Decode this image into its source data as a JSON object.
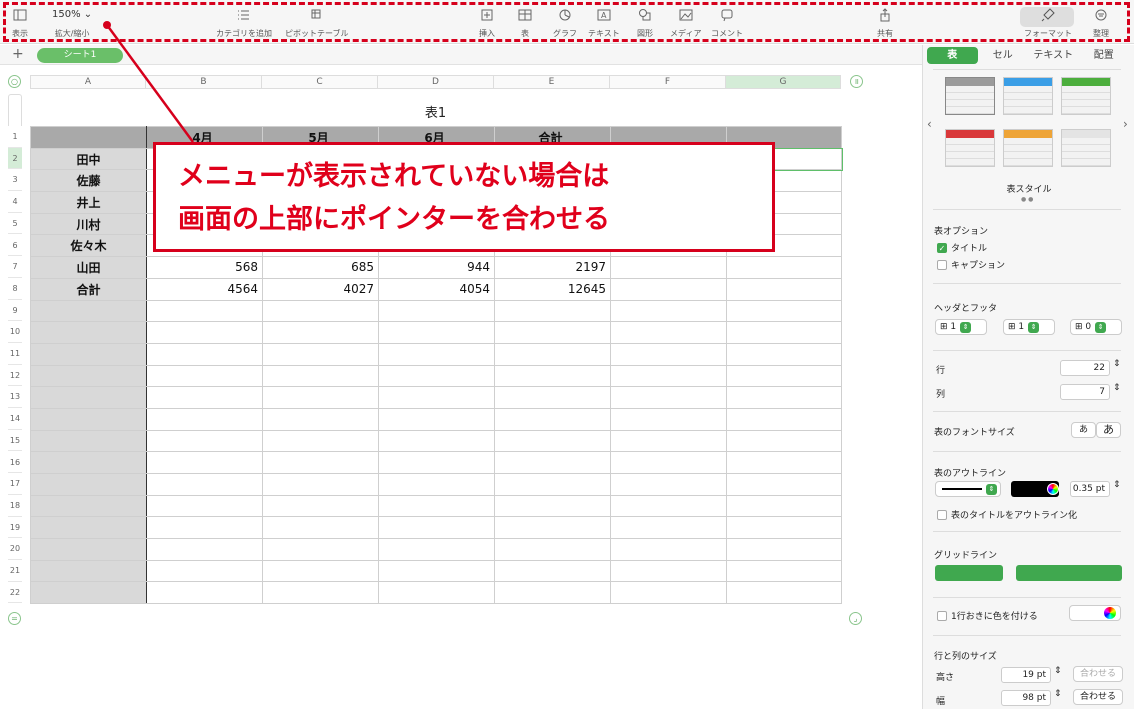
{
  "toolbar": {
    "view_label": "表示",
    "zoom_value": "150% ⌄",
    "zoom_label": "拡大/縮小",
    "category_label": "カテゴリを追加",
    "pivot_label": "ピボットテーブル",
    "insert_label": "挿入",
    "table_label": "表",
    "chart_label": "グラフ",
    "text_label": "テキスト",
    "shape_label": "図形",
    "media_label": "メディア",
    "comment_label": "コメント",
    "share_label": "共有",
    "format_label": "フォーマット",
    "organize_label": "整理"
  },
  "sheets": {
    "add": "+",
    "active": "シート1"
  },
  "columns": [
    "A",
    "B",
    "C",
    "D",
    "E",
    "F",
    "G"
  ],
  "table": {
    "title": "表1",
    "header": [
      "",
      "4月",
      "5月",
      "6月",
      "合計",
      "",
      ""
    ],
    "rows": [
      {
        "name": "田中",
        "v": [
          "",
          "",
          "",
          "",
          "",
          ""
        ]
      },
      {
        "name": "佐藤",
        "v": [
          "",
          "",
          "",
          "",
          "",
          ""
        ]
      },
      {
        "name": "井上",
        "v": [
          "",
          "",
          "",
          "",
          "",
          ""
        ]
      },
      {
        "name": "川村",
        "v": [
          "",
          "",
          "",
          "",
          "",
          ""
        ]
      },
      {
        "name": "佐々木",
        "v": [
          "",
          "",
          "",
          "",
          "",
          ""
        ]
      },
      {
        "name": "山田",
        "v": [
          "568",
          "685",
          "944",
          "2197",
          "",
          ""
        ]
      },
      {
        "name": "合計",
        "v": [
          "4564",
          "4027",
          "4054",
          "12645",
          "",
          ""
        ]
      }
    ],
    "row_count": 22
  },
  "annotation": {
    "line1": "メニューが表示されていない場合は",
    "line2": "画面の上部にポインターを合わせる",
    "color": "#d6001c"
  },
  "panel": {
    "tabs": [
      "表",
      "セル",
      "テキスト",
      "配置"
    ],
    "style_caption": "表スタイル",
    "style_colors": [
      "#9b9b9b",
      "#3a9ee6",
      "#4cae3d",
      "#d9383a",
      "#eea437",
      "#e4e4e4"
    ],
    "options_title": "表オプション",
    "opt_title": "タイトル",
    "opt_caption": "キャプション",
    "hf_title": "ヘッダとフッタ",
    "hf_values": [
      "1",
      "1",
      "0"
    ],
    "rows_label": "行",
    "rows_value": "22",
    "cols_label": "列",
    "cols_value": "7",
    "font_size_label": "表のフォントサイズ",
    "font_small": "あ",
    "font_large": "あ",
    "outline_title": "表のアウトライン",
    "outline_width": "0.35 pt",
    "outline_title_chk": "表のタイトルをアウトライン化",
    "grid_title": "グリッドライン",
    "alt_row": "1行おきに色を付ける",
    "size_title": "行と列のサイズ",
    "height_label": "高さ",
    "height_value": "19 pt",
    "width_label": "幅",
    "width_value": "98 pt",
    "fit_label": "合わせる"
  }
}
